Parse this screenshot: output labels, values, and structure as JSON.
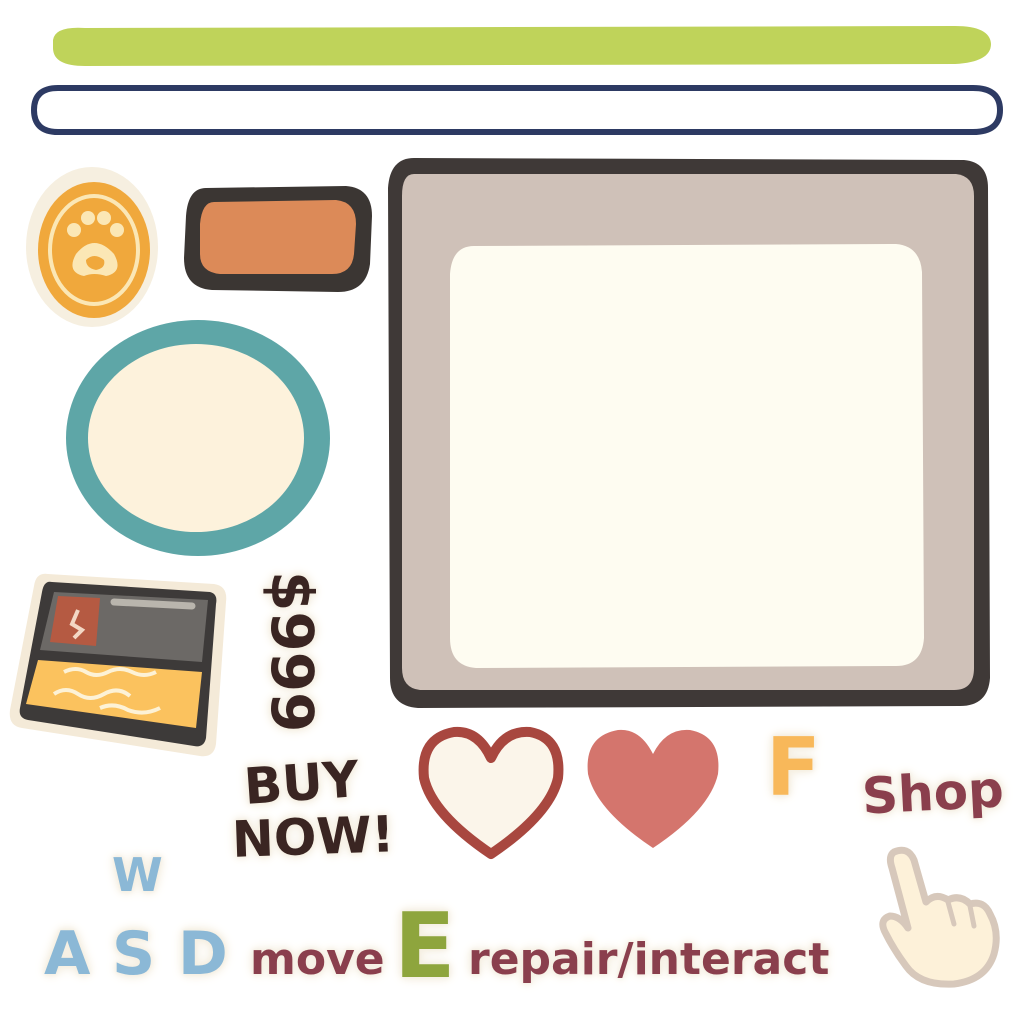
{
  "labels": {
    "buy_now_line1": "BUY",
    "buy_now_line2": "NOW!",
    "shop": "Shop",
    "key_f": "F",
    "key_w": "W",
    "key_a": "A",
    "key_s": "S",
    "key_d": "D",
    "move": "move",
    "key_e": "E",
    "repair_interact": "repair/interact",
    "price": "$999"
  },
  "colors": {
    "green_bar": "#bfd35a",
    "navy_outline": "#2d3a63",
    "coin_orange": "#f0a83c",
    "coin_paw": "#fbe7b5",
    "button_orange": "#dc8a58",
    "button_border": "#3b3633",
    "ring_teal": "#5ea6a7",
    "ring_fill": "#fdf2dc",
    "panel_border": "#3f3937",
    "panel_frame": "#cfc1b8",
    "panel_fill": "#fefcf1",
    "heart_outline": "#a8473f",
    "heart_fill": "#d4756d",
    "key_f": "#f8b85a",
    "shop_text": "#8a3f4d",
    "wasd_blue": "#8bb8d6",
    "move_text": "#8a3f4d",
    "key_e_green": "#8ea53d",
    "price_text": "#3a2522",
    "buy_text": "#3a2522",
    "hand_fill": "#fdf1d9",
    "hand_outline": "#d7c8bb"
  },
  "icons": {
    "coin": "paw-coin-icon",
    "hand": "pointing-hand-icon",
    "heart_empty": "heart-outline-icon",
    "heart_full": "heart-filled-icon",
    "item": "toolbox-item-icon"
  }
}
